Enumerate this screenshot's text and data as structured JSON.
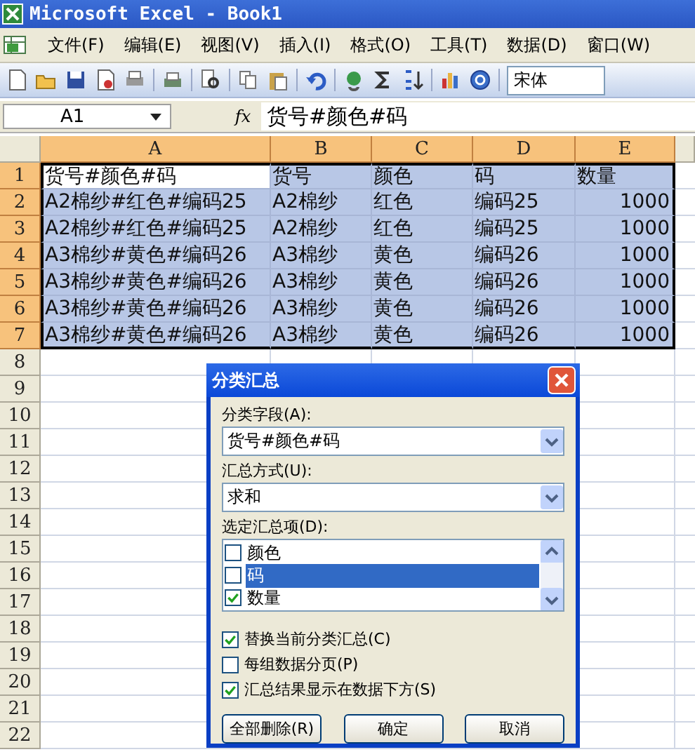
{
  "window": {
    "title": "Microsoft Excel - Book1"
  },
  "menu": [
    {
      "label": "文件(F)"
    },
    {
      "label": "编辑(E)"
    },
    {
      "label": "视图(V)"
    },
    {
      "label": "插入(I)"
    },
    {
      "label": "格式(O)"
    },
    {
      "label": "工具(T)"
    },
    {
      "label": "数据(D)"
    },
    {
      "label": "窗口(W)"
    }
  ],
  "toolbar": {
    "font": "宋体"
  },
  "formula_bar": {
    "name_box": "A1",
    "fx": "fx",
    "value": "货号#颜色#码"
  },
  "sheet": {
    "columns": [
      {
        "label": "A",
        "selected": true,
        "numeric": false
      },
      {
        "label": "B",
        "selected": true,
        "numeric": false
      },
      {
        "label": "C",
        "selected": true,
        "numeric": false
      },
      {
        "label": "D",
        "selected": true,
        "numeric": false
      },
      {
        "label": "E",
        "selected": true,
        "numeric": true
      }
    ],
    "rows": [
      {
        "number": "1",
        "selected": true,
        "kind": "header",
        "active_first_cell": true,
        "cells": [
          "货号#颜色#码",
          "货号",
          "颜色",
          "码",
          "数量"
        ]
      },
      {
        "number": "2",
        "selected": true,
        "kind": "data",
        "cells": [
          "A2棉纱#红色#编码25",
          "A2棉纱",
          "红色",
          "编码25",
          "1000"
        ]
      },
      {
        "number": "3",
        "selected": true,
        "kind": "data",
        "cells": [
          "A2棉纱#红色#编码25",
          "A2棉纱",
          "红色",
          "编码25",
          "1000"
        ]
      },
      {
        "number": "4",
        "selected": true,
        "kind": "data",
        "cells": [
          "A3棉纱#黄色#编码26",
          "A3棉纱",
          "黄色",
          "编码26",
          "1000"
        ]
      },
      {
        "number": "5",
        "selected": true,
        "kind": "data",
        "cells": [
          "A3棉纱#黄色#编码26",
          "A3棉纱",
          "黄色",
          "编码26",
          "1000"
        ]
      },
      {
        "number": "6",
        "selected": true,
        "kind": "data",
        "cells": [
          "A3棉纱#黄色#编码26",
          "A3棉纱",
          "黄色",
          "编码26",
          "1000"
        ]
      },
      {
        "number": "7",
        "selected": true,
        "kind": "data",
        "cells": [
          "A3棉纱#黄色#编码26",
          "A3棉纱",
          "黄色",
          "编码26",
          "1000"
        ]
      },
      {
        "number": "8",
        "selected": false,
        "kind": "empty",
        "cells": []
      },
      {
        "number": "9",
        "selected": false,
        "kind": "empty",
        "cells": []
      },
      {
        "number": "10",
        "selected": false,
        "kind": "empty",
        "cells": []
      },
      {
        "number": "11",
        "selected": false,
        "kind": "empty",
        "cells": []
      },
      {
        "number": "12",
        "selected": false,
        "kind": "empty",
        "cells": []
      },
      {
        "number": "13",
        "selected": false,
        "kind": "empty",
        "cells": []
      },
      {
        "number": "14",
        "selected": false,
        "kind": "empty",
        "cells": []
      },
      {
        "number": "15",
        "selected": false,
        "kind": "empty",
        "cells": []
      },
      {
        "number": "16",
        "selected": false,
        "kind": "empty",
        "cells": []
      },
      {
        "number": "17",
        "selected": false,
        "kind": "empty",
        "cells": []
      },
      {
        "number": "18",
        "selected": false,
        "kind": "empty",
        "cells": []
      },
      {
        "number": "19",
        "selected": false,
        "kind": "empty",
        "cells": []
      },
      {
        "number": "20",
        "selected": false,
        "kind": "empty",
        "cells": []
      },
      {
        "number": "21",
        "selected": false,
        "kind": "empty",
        "cells": []
      },
      {
        "number": "22",
        "selected": false,
        "kind": "empty",
        "cells": []
      }
    ]
  },
  "dialog": {
    "title": "分类汇总",
    "group_by": {
      "label": "分类字段(A):",
      "value": "货号#颜色#码"
    },
    "function": {
      "label": "汇总方式(U):",
      "value": "求和"
    },
    "items": {
      "label": "选定汇总项(D):",
      "list": [
        {
          "label": "颜色",
          "checked": false,
          "selected": false
        },
        {
          "label": "码",
          "checked": false,
          "selected": true
        },
        {
          "label": "数量",
          "checked": true,
          "selected": false
        }
      ]
    },
    "options": [
      {
        "label": "替换当前分类汇总(C)",
        "checked": true
      },
      {
        "label": "每组数据分页(P)",
        "checked": false
      },
      {
        "label": "汇总结果显示在数据下方(S)",
        "checked": true
      }
    ],
    "buttons": [
      {
        "label": "全部删除(R)"
      },
      {
        "label": "确定"
      },
      {
        "label": "取消"
      }
    ]
  }
}
